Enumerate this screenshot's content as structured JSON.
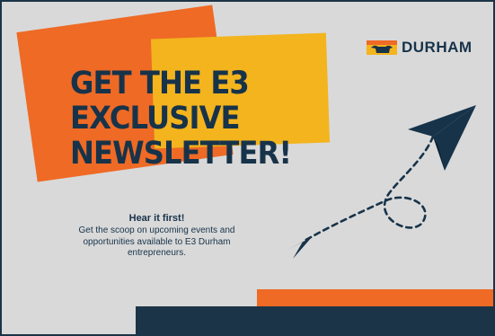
{
  "headline": {
    "line1": "GET THE E3",
    "line2": "EXCLUSIVE",
    "line3": "NEWSLETTER!"
  },
  "brand": {
    "name": "DURHAM",
    "logo_icon": "bull-logo-icon"
  },
  "blurb": {
    "title": "Hear it first!",
    "body": "Get the scoop on upcoming events and opportunities available to E3 Durham entrepreneurs."
  },
  "colors": {
    "navy": "#1c3447",
    "orange": "#ee6a25",
    "yellow": "#f3b41d",
    "background": "#d9d9d9"
  },
  "icons": [
    "paper-plane-icon",
    "dashed-flight-path",
    "arrow-head-icon"
  ]
}
